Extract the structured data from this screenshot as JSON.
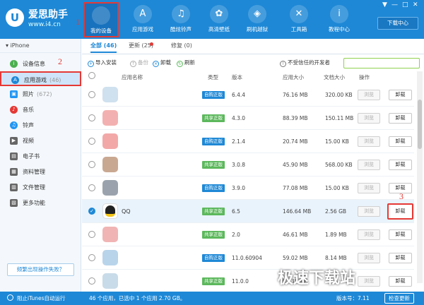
{
  "app": {
    "title": "爱思助手",
    "url": "www.i4.cn"
  },
  "nav": [
    {
      "label": "我的设备",
      "icon": "apple-icon",
      "glyph": ""
    },
    {
      "label": "应用游戏",
      "icon": "appstore-icon",
      "glyph": "A"
    },
    {
      "label": "酷炫铃声",
      "icon": "bell-icon",
      "glyph": "♫"
    },
    {
      "label": "高清壁纸",
      "icon": "flower-icon",
      "glyph": "✿"
    },
    {
      "label": "刷机越狱",
      "icon": "dropbox-icon",
      "glyph": "◈"
    },
    {
      "label": "工具箱",
      "icon": "tools-icon",
      "glyph": "✕"
    },
    {
      "label": "教程中心",
      "icon": "info-icon",
      "glyph": "i"
    }
  ],
  "window_controls": [
    "▼",
    "—",
    "□",
    "✕"
  ],
  "download_center": "下载中心",
  "device_name": "iPhone",
  "sidebar": [
    {
      "label": "设备信息",
      "count": "",
      "color": "#4caf50",
      "glyph": "i"
    },
    {
      "label": "应用游戏",
      "count": "(46)",
      "color": "#1e88d6",
      "glyph": "A"
    },
    {
      "label": "照片",
      "count": "(672)",
      "color": "#2196f3",
      "glyph": "▣"
    },
    {
      "label": "音乐",
      "count": "",
      "color": "#e53935",
      "glyph": "♪"
    },
    {
      "label": "铃声",
      "count": "",
      "color": "#2196f3",
      "glyph": "♫"
    },
    {
      "label": "视频",
      "count": "",
      "color": "#555",
      "glyph": "▶"
    },
    {
      "label": "电子书",
      "count": "",
      "color": "#555",
      "glyph": "▤"
    },
    {
      "label": "资料管理",
      "count": "",
      "color": "#555",
      "glyph": "▦"
    },
    {
      "label": "文件管理",
      "count": "",
      "color": "#555",
      "glyph": "▥"
    },
    {
      "label": "更多功能",
      "count": "",
      "color": "#555",
      "glyph": "▧"
    }
  ],
  "notice_button": "频繁出现操作失败？",
  "tabs": [
    {
      "label": "全部 (46)"
    },
    {
      "label": "更新 (25)"
    },
    {
      "label": "修复 (0)"
    }
  ],
  "toolbar": {
    "import": "导入安装",
    "backup": "备份",
    "uninstall": "卸载",
    "refresh": "刷新",
    "untrusted": "不受信任的开发者"
  },
  "columns": {
    "name": "应用名称",
    "type": "类型",
    "version": "版本",
    "app_size": "应用大小",
    "doc_size": "文档大小",
    "action": "操作"
  },
  "badge_labels": {
    "bought": "自购正版",
    "shared": "共享正版"
  },
  "rows": [
    {
      "name": "",
      "type": "自购正版",
      "version": "6.4.4",
      "app_size": "76.16 MB",
      "doc_size": "320.00 KB",
      "icon_color": "#cfe0ee",
      "checked": false
    },
    {
      "name": "",
      "type": "共享正版",
      "version": "4.3.0",
      "app_size": "88.39 MB",
      "doc_size": "150.11 MB",
      "icon_color": "#f3b0b0",
      "checked": false
    },
    {
      "name": "",
      "type": "自购正版",
      "version": "2.1.4",
      "app_size": "20.74 MB",
      "doc_size": "15.00 KB",
      "icon_color": "#f3a8a8",
      "checked": false
    },
    {
      "name": "",
      "type": "共享正版",
      "version": "3.0.8",
      "app_size": "45.90 MB",
      "doc_size": "568.00 KB",
      "icon_color": "#c9a892",
      "checked": false
    },
    {
      "name": "",
      "type": "自购正版",
      "version": "3.9.0",
      "app_size": "77.08 MB",
      "doc_size": "15.00 KB",
      "icon_color": "#9aa3ad",
      "checked": false
    },
    {
      "name": "QQ",
      "type": "共享正版",
      "version": "6.5",
      "app_size": "146.64 MB",
      "doc_size": "2.56 GB",
      "icon_color": "#222",
      "checked": true
    },
    {
      "name": "",
      "type": "共享正版",
      "version": "2.0",
      "app_size": "46.61 MB",
      "doc_size": "1.89 MB",
      "icon_color": "#f0b4b4",
      "checked": false
    },
    {
      "name": "",
      "type": "自购正版",
      "version": "11.0.60904",
      "app_size": "59.02 MB",
      "doc_size": "8.14 MB",
      "icon_color": "#b8d4ea",
      "checked": false
    },
    {
      "name": "",
      "type": "共享正版",
      "version": "11.0.0",
      "app_size": "92.35 MB",
      "doc_size": "",
      "icon_color": "#c8dbe9",
      "checked": false
    }
  ],
  "row_buttons": {
    "view": "浏览",
    "uninstall": "卸载"
  },
  "statusbar": {
    "itunes": "阻止iTunes自动运行",
    "summary": "46 个应用，已选中 1 个应用 2.70 GB。",
    "version": "版本号：7.11",
    "update": "检查更新"
  },
  "steps": [
    "1",
    "2",
    "3"
  ],
  "watermark": "极速下载站",
  "colors": {
    "accent": "#1e88d6",
    "highlight": "#e53935",
    "bought": "#1e88d6",
    "shared": "#5cb85c"
  }
}
